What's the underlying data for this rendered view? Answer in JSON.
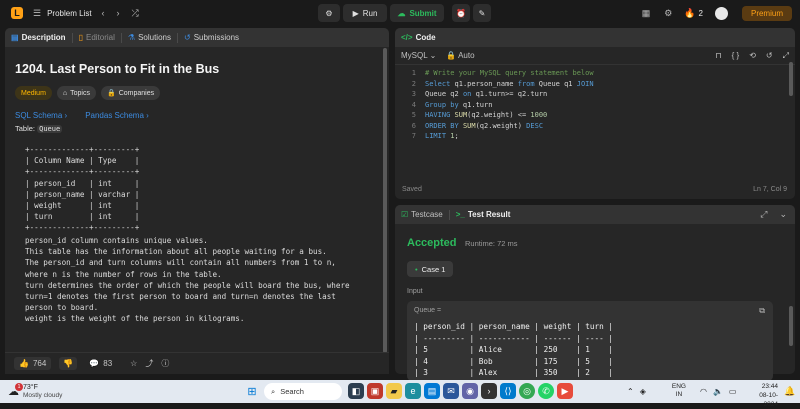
{
  "topbar": {
    "problem_list": "Problem List",
    "run": "Run",
    "submit": "Submit",
    "streak": "2",
    "premium": "Premium"
  },
  "left": {
    "tabs": [
      "Description",
      "Editorial",
      "Solutions",
      "Submissions"
    ],
    "title": "1204. Last Person to Fit in the Bus",
    "badges": {
      "difficulty": "Medium",
      "topics": "Topics",
      "companies": "Companies"
    },
    "links": [
      "SQL Schema",
      "Pandas Schema"
    ],
    "table_label": "Table:",
    "table_name": "Queue",
    "schema_text": "+-------------+---------+\n| Column Name | Type    |\n+-------------+---------+\n| person_id   | int     |\n| person_name | varchar |\n| weight      | int     |\n| turn        | int     |\n+-------------+---------+",
    "desc_text": "person_id column contains unique values.\nThis table has the information about all people waiting for a bus.\nThe person_id and turn columns will contain all numbers from 1 to n,\nwhere n is the number of rows in the table.\nturn determines the order of which the people will board the bus, where\nturn=1 denotes the first person to board and turn=n denotes the last\nperson to board.\nweight is the weight of the person in kilograms.",
    "likes": "764",
    "comments": "83"
  },
  "code": {
    "tab": "Code",
    "language": "MySQL",
    "auto": "Auto",
    "saved": "Saved",
    "position": "Ln 7, Col 9"
  },
  "result": {
    "tabs": [
      "Testcase",
      "Test Result"
    ],
    "status": "Accepted",
    "runtime": "Runtime: 72 ms",
    "case": "Case 1",
    "input_label": "Input",
    "queue_label": "Queue =",
    "table_text": "| person_id | person_name | weight | turn |\n| --------- | ----------- | ------ | ---- |\n| 5         | Alice       | 250    | 1    |\n| 4         | Bob         | 175    | 5    |\n| 3         | Alex        | 350    | 2    |"
  },
  "taskbar": {
    "temp": "73°F",
    "weather": "Mostly cloudy",
    "search": "Search",
    "lang1": "ENG",
    "lang2": "IN",
    "time": "23:44",
    "date": "08-10-2024",
    "weather_badge": "1"
  },
  "colors": {
    "accent": "#ffa116",
    "accepted": "#2cbb5d",
    "submit": "#2cbb5d",
    "link": "#3c8be0"
  }
}
